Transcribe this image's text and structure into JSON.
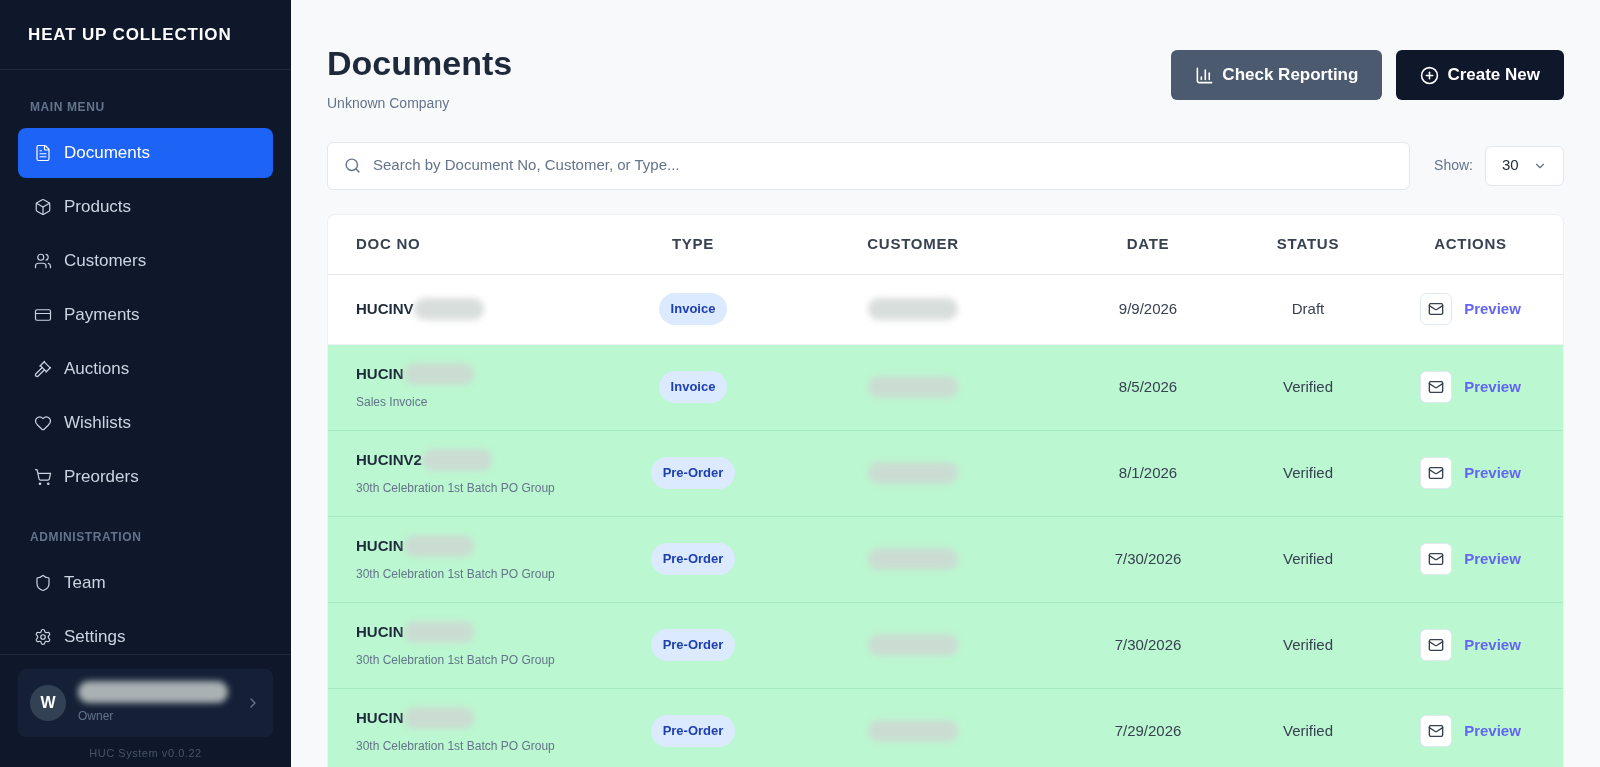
{
  "brand": "HEAT UP COLLECTION",
  "sidebar": {
    "sections": [
      {
        "heading": "MAIN MENU",
        "items": [
          {
            "label": "Documents",
            "selected": true
          },
          {
            "label": "Products",
            "selected": false
          },
          {
            "label": "Customers",
            "selected": false
          },
          {
            "label": "Payments",
            "selected": false
          },
          {
            "label": "Auctions",
            "selected": false
          },
          {
            "label": "Wishlists",
            "selected": false
          },
          {
            "label": "Preorders",
            "selected": false
          }
        ]
      },
      {
        "heading": "ADMINISTRATION",
        "items": [
          {
            "label": "Team",
            "selected": false
          },
          {
            "label": "Settings",
            "selected": false
          }
        ]
      }
    ],
    "user": {
      "initial": "W",
      "role": "Owner"
    },
    "version": "HUC System v0.0.22"
  },
  "page": {
    "title": "Documents",
    "subtitle": "Unknown Company"
  },
  "buttons": [
    {
      "label": "Check Reporting",
      "kind": "secondary"
    },
    {
      "label": "Create New",
      "kind": "primary"
    }
  ],
  "search": {
    "placeholder": "Search by Document No, Customer, or Type..."
  },
  "show": {
    "label": "Show:",
    "value": "30"
  },
  "table": {
    "columns": [
      "DOC NO",
      "TYPE",
      "CUSTOMER",
      "DATE",
      "STATUS",
      "ACTIONS"
    ],
    "rows": [
      {
        "doc_no": "HUCINV",
        "type": "Invoice",
        "date": "9/9/2026",
        "status": "Draft",
        "highlighted": false,
        "action": "Preview"
      },
      {
        "doc_no": "HUCIN",
        "note": "Sales Invoice",
        "type": "Invoice",
        "date": "8/5/2026",
        "status": "Verified",
        "highlighted": true,
        "action": "Preview"
      },
      {
        "doc_no": "HUCINV2",
        "note": "30th Celebration 1st Batch PO Group",
        "type": "Pre-Order",
        "date": "8/1/2026",
        "status": "Verified",
        "highlighted": true,
        "action": "Preview"
      },
      {
        "doc_no": "HUCIN",
        "note": "30th Celebration 1st Batch PO Group",
        "type": "Pre-Order",
        "date": "7/30/2026",
        "status": "Verified",
        "highlighted": true,
        "action": "Preview"
      },
      {
        "doc_no": "HUCIN",
        "note": "30th Celebration 1st Batch PO Group",
        "type": "Pre-Order",
        "date": "7/30/2026",
        "status": "Verified",
        "highlighted": true,
        "action": "Preview"
      },
      {
        "doc_no": "HUCIN",
        "note": "30th Celebration 1st Batch PO Group",
        "type": "Pre-Order",
        "date": "7/29/2026",
        "status": "Verified",
        "highlighted": true,
        "action": "Preview"
      }
    ]
  }
}
